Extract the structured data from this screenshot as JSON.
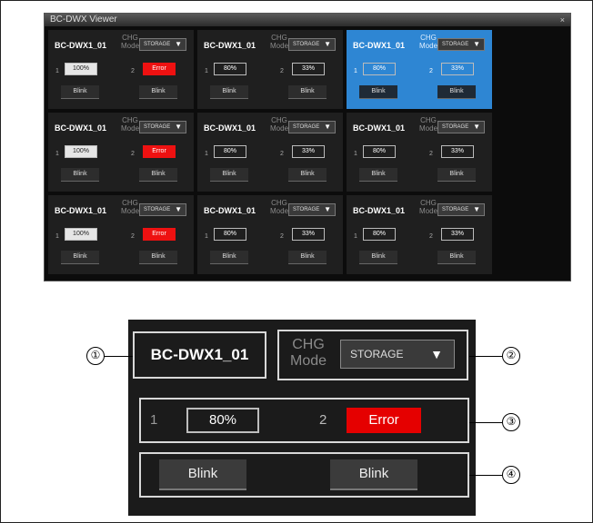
{
  "viewer": {
    "title": "BC-DWX Viewer",
    "close_label": "×",
    "cells": [
      {
        "name": "BC-DWX1_01",
        "mode_label": "CHG\nMode",
        "mode_value": "STORAGE",
        "dropdown_arrow": "▼",
        "idx1": "1",
        "bat1": "100%",
        "idx2": "2",
        "bat2": "Error",
        "blink1": "Blink",
        "blink2": "Blink",
        "selected": false,
        "bat1_full": true,
        "bat2_error": true
      },
      {
        "name": "BC-DWX1_01",
        "mode_label": "CHG\nMode",
        "mode_value": "STORAGE",
        "dropdown_arrow": "▼",
        "idx1": "1",
        "bat1": "80%",
        "idx2": "2",
        "bat2": "33%",
        "blink1": "Blink",
        "blink2": "Blink",
        "selected": false,
        "bat1_full": false,
        "bat2_error": false
      },
      {
        "name": "BC-DWX1_01",
        "mode_label": "CHG\nMode",
        "mode_value": "STORAGE",
        "dropdown_arrow": "▼",
        "idx1": "1",
        "bat1": "80%",
        "idx2": "2",
        "bat2": "33%",
        "blink1": "Blink",
        "blink2": "Blink",
        "selected": true,
        "bat1_full": false,
        "bat2_error": false
      },
      {
        "name": "BC-DWX1_01",
        "mode_label": "CHG\nMode",
        "mode_value": "STORAGE",
        "dropdown_arrow": "▼",
        "idx1": "1",
        "bat1": "100%",
        "idx2": "2",
        "bat2": "Error",
        "blink1": "Blink",
        "blink2": "Blink",
        "selected": false,
        "bat1_full": true,
        "bat2_error": true
      },
      {
        "name": "BC-DWX1_01",
        "mode_label": "CHG\nMode",
        "mode_value": "STORAGE",
        "dropdown_arrow": "▼",
        "idx1": "1",
        "bat1": "80%",
        "idx2": "2",
        "bat2": "33%",
        "blink1": "Blink",
        "blink2": "Blink",
        "selected": false,
        "bat1_full": false,
        "bat2_error": false
      },
      {
        "name": "BC-DWX1_01",
        "mode_label": "CHG\nMode",
        "mode_value": "STORAGE",
        "dropdown_arrow": "▼",
        "idx1": "1",
        "bat1": "80%",
        "idx2": "2",
        "bat2": "33%",
        "blink1": "Blink",
        "blink2": "Blink",
        "selected": false,
        "bat1_full": false,
        "bat2_error": false
      },
      {
        "name": "BC-DWX1_01",
        "mode_label": "CHG\nMode",
        "mode_value": "STORAGE",
        "dropdown_arrow": "▼",
        "idx1": "1",
        "bat1": "100%",
        "idx2": "2",
        "bat2": "Error",
        "blink1": "Blink",
        "blink2": "Blink",
        "selected": false,
        "bat1_full": true,
        "bat2_error": true
      },
      {
        "name": "BC-DWX1_01",
        "mode_label": "CHG\nMode",
        "mode_value": "STORAGE",
        "dropdown_arrow": "▼",
        "idx1": "1",
        "bat1": "80%",
        "idx2": "2",
        "bat2": "33%",
        "blink1": "Blink",
        "blink2": "Blink",
        "selected": false,
        "bat1_full": false,
        "bat2_error": false
      },
      {
        "name": "BC-DWX1_01",
        "mode_label": "CHG\nMode",
        "mode_value": "STORAGE",
        "dropdown_arrow": "▼",
        "idx1": "1",
        "bat1": "80%",
        "idx2": "2",
        "bat2": "33%",
        "blink1": "Blink",
        "blink2": "Blink",
        "selected": false,
        "bat1_full": false,
        "bat2_error": false
      }
    ]
  },
  "detail": {
    "name": "BC-DWX1_01",
    "mode_label": "CHG\nMode",
    "mode_value": "STORAGE",
    "dropdown_arrow": "▼",
    "idx1": "1",
    "bat1": "80%",
    "idx2": "2",
    "bat2": "Error",
    "blink1": "Blink",
    "blink2": "Blink"
  },
  "callouts": [
    "①",
    "②",
    "③",
    "④"
  ],
  "colors": {
    "selected_cell": "#2e86d3",
    "error": "#e50000",
    "panel": "#1b1b1b"
  }
}
